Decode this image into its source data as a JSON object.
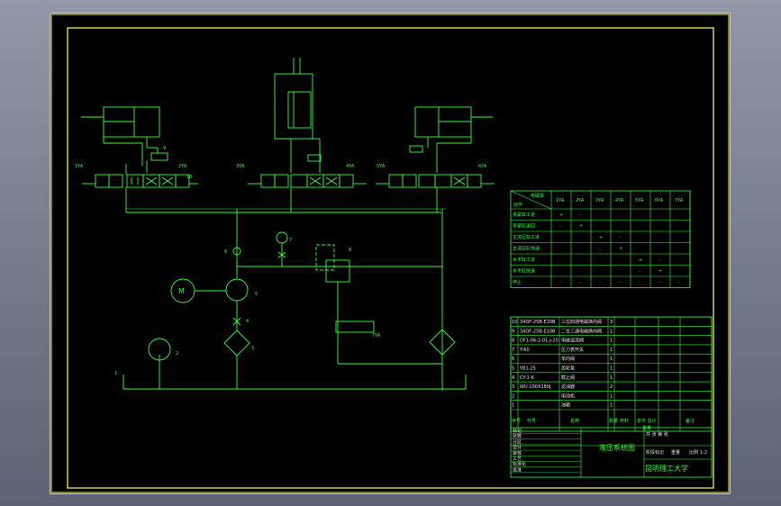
{
  "drawing_title": "液压系统图",
  "university": "昆明理工大学",
  "scale": "1:2",
  "colors": {
    "background": "#000000",
    "line": "#39ff39",
    "frame": "#ffff66",
    "note": "#e6e6e6"
  },
  "component_numbers": [
    "1",
    "2",
    "3",
    "4",
    "5",
    "6",
    "7",
    "8",
    "9",
    "10"
  ],
  "motor_label": "M",
  "solenoid_labels": [
    "1YA",
    "2YA",
    "3YA",
    "4YA",
    "5YA",
    "6YA",
    "7YA"
  ],
  "action_table": {
    "corner_top": "电磁铁",
    "corner_bottom": "动作",
    "columns": [
      "1YA",
      "2YA",
      "3YA",
      "4YA",
      "5YA",
      "6YA",
      "7YA"
    ],
    "rows": [
      {
        "action": "夹紧缸工进",
        "marks": [
          "+",
          "-",
          "",
          "",
          "",
          "",
          ""
        ]
      },
      {
        "action": "夹紧缸退回",
        "marks": [
          "-",
          "+",
          "",
          "",
          "",
          "",
          ""
        ]
      },
      {
        "action": "主液压缸工进",
        "marks": [
          "",
          "",
          "+",
          "-",
          "",
          "",
          ""
        ]
      },
      {
        "action": "主液压缸快退",
        "marks": [
          "",
          "",
          "-",
          "+",
          "",
          "",
          ""
        ]
      },
      {
        "action": "水平缸工进",
        "marks": [
          "",
          "",
          "",
          "",
          "+",
          "-",
          ""
        ]
      },
      {
        "action": "水平缸快退",
        "marks": [
          "",
          "",
          "",
          "",
          "-",
          "+",
          ""
        ]
      },
      {
        "action": "停止",
        "marks": [
          "-",
          "-",
          "-",
          "-",
          "-",
          "-",
          "-"
        ]
      }
    ]
  },
  "parts_list": {
    "rows": [
      {
        "no": "10",
        "code": "34DF-25B-E10B",
        "name": "三位四通电磁换向阀",
        "qty": "3"
      },
      {
        "no": "9",
        "code": "34DF-25B-E10B",
        "name": "二位三通电磁换向阀",
        "qty": "1"
      },
      {
        "no": "8",
        "code": "DF1-06-2-01-J-20",
        "name": "电磁溢流阀",
        "qty": "1"
      },
      {
        "no": "7",
        "code": "Y-60",
        "name": "压力表开关",
        "qty": "1"
      },
      {
        "no": "6",
        "code": "",
        "name": "单向阀",
        "qty": "1"
      },
      {
        "no": "5",
        "code": "YB1-25",
        "name": "齿轮泵",
        "qty": "1"
      },
      {
        "no": "4",
        "code": "CY-1-6",
        "name": "截止阀",
        "qty": "1"
      },
      {
        "no": "3",
        "code": "WU-100X180J",
        "name": "滤油器",
        "qty": "2"
      },
      {
        "no": "2",
        "code": "",
        "name": "电动机",
        "qty": "1"
      },
      {
        "no": "1",
        "code": "",
        "name": "油箱",
        "qty": "1"
      }
    ],
    "header": {
      "no": "序号",
      "code": "代号",
      "name": "名称",
      "qty": "数量",
      "material": "材料",
      "weight": "单件 总计",
      "mass_label": "重量",
      "note": "备注"
    }
  },
  "title_block": {
    "labels": [
      "标记",
      "处数",
      "分区",
      "设计",
      "审核",
      "工艺",
      "标准化",
      "批准"
    ],
    "stage_label": "阶段标记",
    "weight_label": "重量",
    "scale_label": "比例",
    "sheet": "共 张 第 张"
  }
}
